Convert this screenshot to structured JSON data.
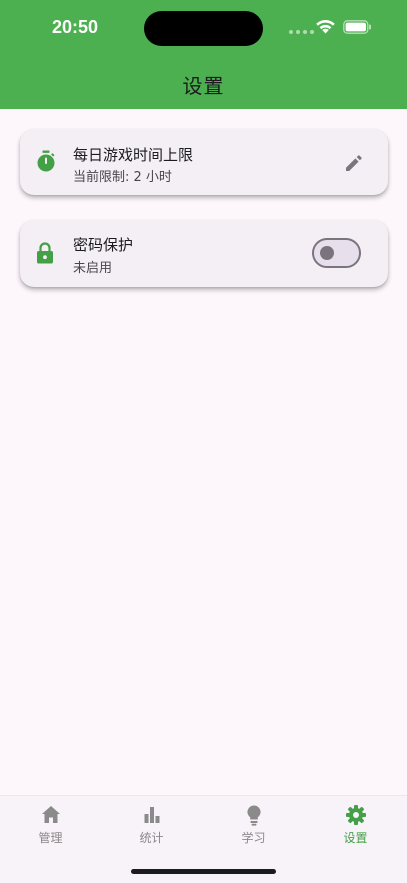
{
  "status_bar": {
    "time": "20:50"
  },
  "header": {
    "title": "设置"
  },
  "settings": {
    "daily_limit": {
      "title": "每日游戏时间上限",
      "subtitle": "当前限制: 2 小时",
      "icon": "timer-icon",
      "action_icon": "edit-icon"
    },
    "password": {
      "title": "密码保护",
      "subtitle": "未启用",
      "icon": "lock-icon",
      "enabled": false
    }
  },
  "bottom_nav": {
    "items": [
      {
        "label": "管理",
        "icon": "home-icon",
        "active": false
      },
      {
        "label": "统计",
        "icon": "bar-chart-icon",
        "active": false
      },
      {
        "label": "学习",
        "icon": "lightbulb-icon",
        "active": false
      },
      {
        "label": "设置",
        "icon": "gear-icon",
        "active": true
      }
    ]
  },
  "colors": {
    "primary": "#4caf50",
    "active_nav": "#43a047",
    "inactive_nav": "#8a8a8a",
    "background": "#fdf7fc",
    "card": "#f4eff4"
  }
}
